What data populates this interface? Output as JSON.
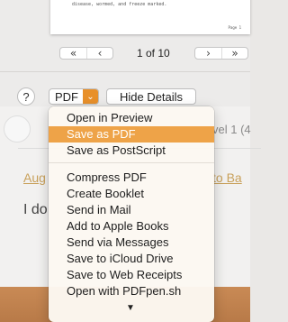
{
  "preview": {
    "text_line": "disease, wormed, and freeze marked.",
    "page_label": "Page 1"
  },
  "pager": {
    "first_label": "«",
    "prev_label": "‹",
    "indicator": "1 of 10",
    "next_label": "›",
    "last_label": "»"
  },
  "controls": {
    "help_label": "?",
    "pdf_label": "PDF",
    "pdf_arrow": "⌄",
    "hide_details_label": "Hide Details"
  },
  "background": {
    "level_text": "vel 1 (4",
    "aug_text": "Aug",
    "to_text": "to Ba",
    "ido_text": "I do"
  },
  "menu": {
    "group1": [
      "Open in Preview",
      "Save as PDF",
      "Save as PostScript"
    ],
    "selected_index": 1,
    "group2": [
      "Compress PDF",
      "Create Booklet",
      "Send in Mail",
      "Add to Apple Books",
      "Send via Messages",
      "Save to iCloud Drive",
      "Save to Web Receipts",
      "Open with PDFpen.sh"
    ],
    "more_arrow": "▼"
  },
  "colors": {
    "accent": "#e8902a",
    "menu_highlight": "#eea348",
    "desk": "#c98a55"
  }
}
